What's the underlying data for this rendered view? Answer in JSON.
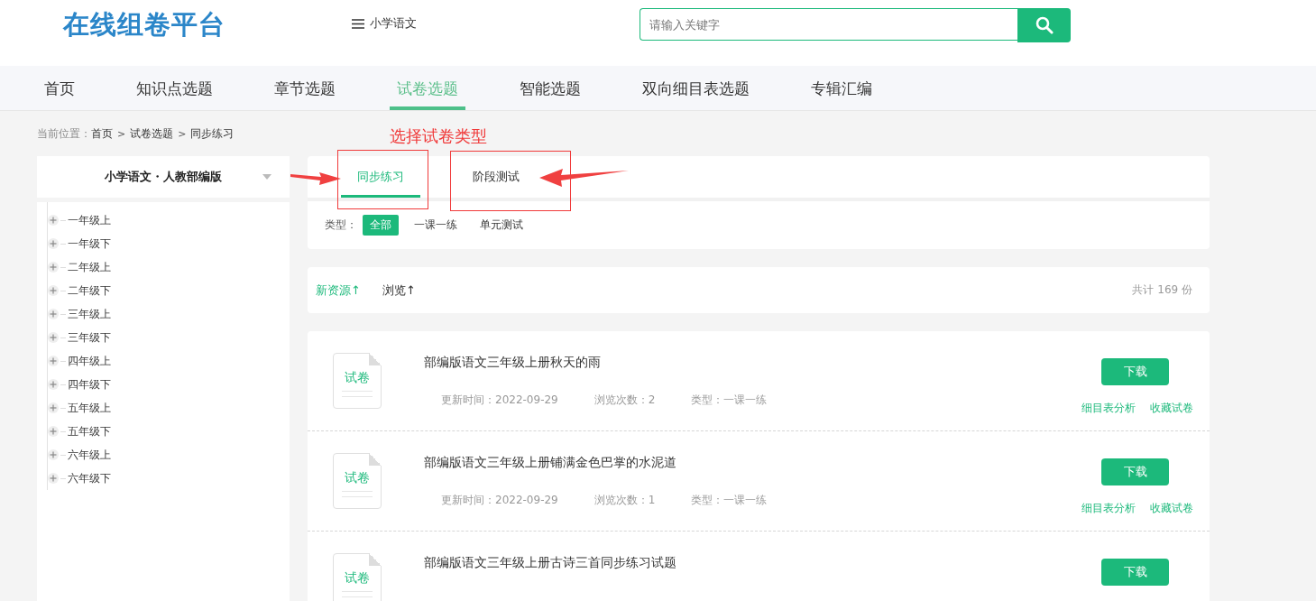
{
  "header": {
    "logo": "在线组卷平台",
    "subject_menu": "小学语文",
    "search": {
      "placeholder": "请输入关键字"
    }
  },
  "nav": [
    {
      "label": "首页",
      "selected": false
    },
    {
      "label": "知识点选题",
      "selected": false
    },
    {
      "label": "章节选题",
      "selected": false
    },
    {
      "label": "试卷选题",
      "selected": true
    },
    {
      "label": "智能选题",
      "selected": false
    },
    {
      "label": "双向细目表选题",
      "selected": false
    },
    {
      "label": "专辑汇编",
      "selected": false
    }
  ],
  "breadcrumb": {
    "prefix": "当前位置：",
    "separator": ">",
    "items": [
      "首页",
      "试卷选题",
      "同步练习"
    ]
  },
  "annotation": {
    "label": "选择试卷类型"
  },
  "sidebar": {
    "title": "小学语文・人教部编版",
    "tree": [
      {
        "label": "一年级上",
        "expanded": false
      },
      {
        "label": "一年级下",
        "expanded": false
      },
      {
        "label": "二年级上",
        "expanded": false
      },
      {
        "label": "二年级下",
        "expanded": false
      },
      {
        "label": "三年级上",
        "expanded": false
      },
      {
        "label": "三年级下",
        "expanded": false
      },
      {
        "label": "四年级上",
        "expanded": false
      },
      {
        "label": "四年级下",
        "expanded": false
      },
      {
        "label": "五年级上",
        "expanded": false
      },
      {
        "label": "五年级下",
        "expanded": false
      },
      {
        "label": "六年级上",
        "expanded": false
      },
      {
        "label": "六年级下",
        "expanded": false
      }
    ]
  },
  "paper_tabs": [
    {
      "label": "同步练习",
      "selected": true
    },
    {
      "label": "阶段测试",
      "selected": false
    }
  ],
  "filter": {
    "label": "类型：",
    "options": [
      {
        "label": "全部",
        "selected": true
      },
      {
        "label": "一课一练",
        "selected": false
      },
      {
        "label": "单元测试",
        "selected": false
      }
    ]
  },
  "sort": {
    "options": [
      {
        "label": "新资源↑",
        "selected": true
      },
      {
        "label": "浏览↑",
        "selected": false
      }
    ],
    "total": "共计 169 份"
  },
  "papers": [
    {
      "icon_label": "试卷",
      "title": "部编版语文三年级上册秋天的雨",
      "meta": [
        "更新时间：2022-09-29",
        "浏览次数：2",
        "类型：一课一练"
      ],
      "download": "下载",
      "links": [
        "细目表分析",
        "收藏试卷"
      ]
    },
    {
      "icon_label": "试卷",
      "title": "部编版语文三年级上册铺满金色巴掌的水泥道",
      "meta": [
        "更新时间：2022-09-29",
        "浏览次数：1",
        "类型：一课一练"
      ],
      "download": "下载",
      "links": [
        "细目表分析",
        "收藏试卷"
      ]
    },
    {
      "icon_label": "试卷",
      "title": "部编版语文三年级上册古诗三首同步练习试题",
      "download": "下载"
    }
  ]
}
